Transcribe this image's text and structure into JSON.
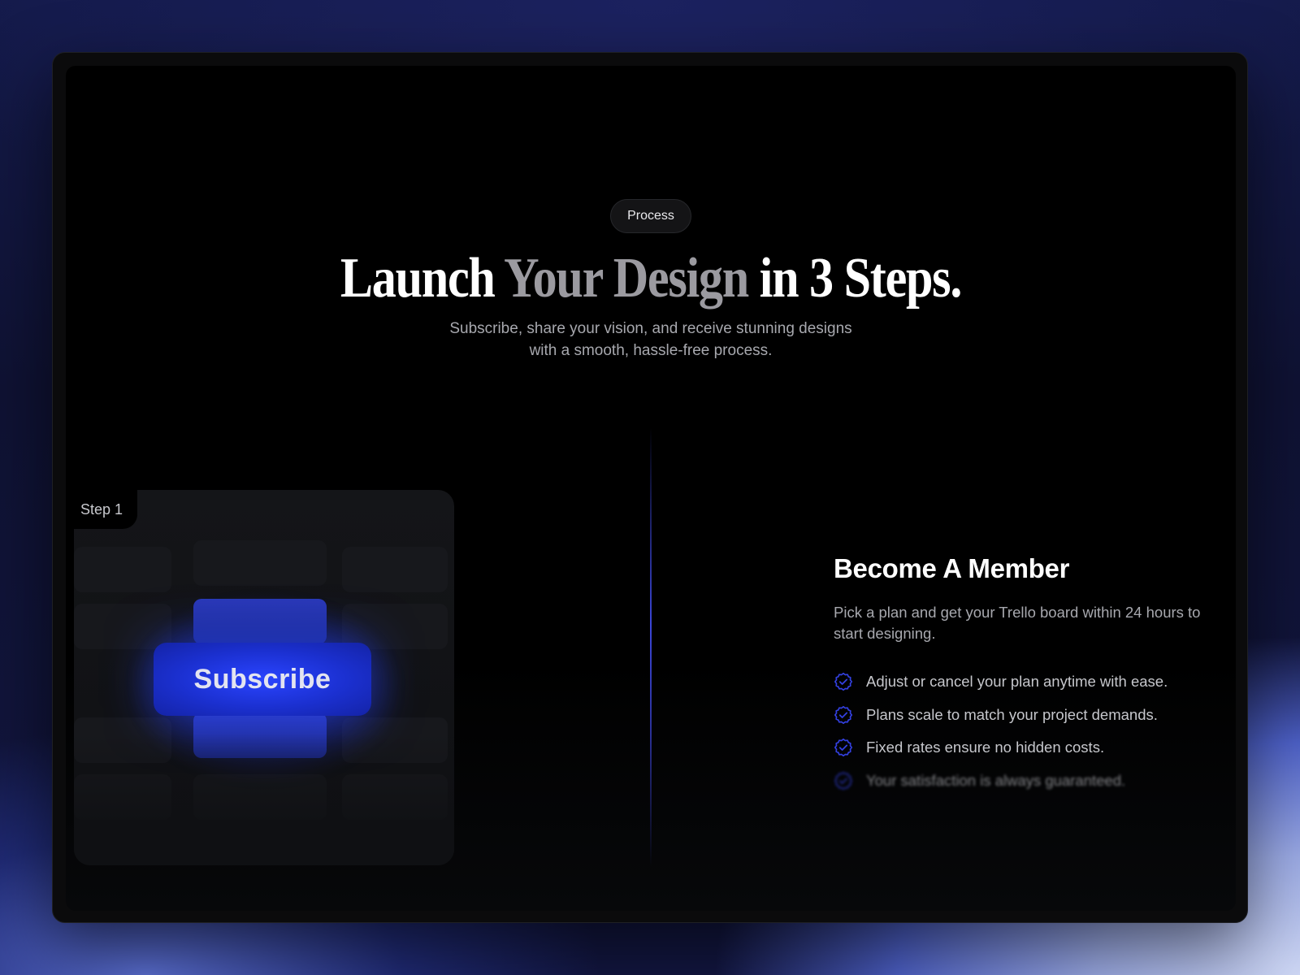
{
  "badge": "Process",
  "title": {
    "part1": "Launch ",
    "accent": "Your Design",
    "part2": " in 3 Steps."
  },
  "subtitle": "Subscribe, share your vision, and receive stunning designs with a smooth, hassle-free process.",
  "step": {
    "label": "Step 1",
    "button_label": "Subscribe"
  },
  "member": {
    "title": "Become A Member",
    "description": "Pick a plan and get your Trello board within 24 hours to start designing.",
    "features": [
      "Adjust or cancel your plan anytime with ease.",
      "Plans scale to match your project demands.",
      "Fixed rates ensure no hidden costs.",
      "Your satisfaction is always guaranteed."
    ]
  },
  "colors": {
    "accent_blue": "#2a44ff",
    "title_accent": "#9b9aa0",
    "check_icon": "#3340e0"
  },
  "icons": {
    "feature_check": "verified-check-icon"
  }
}
